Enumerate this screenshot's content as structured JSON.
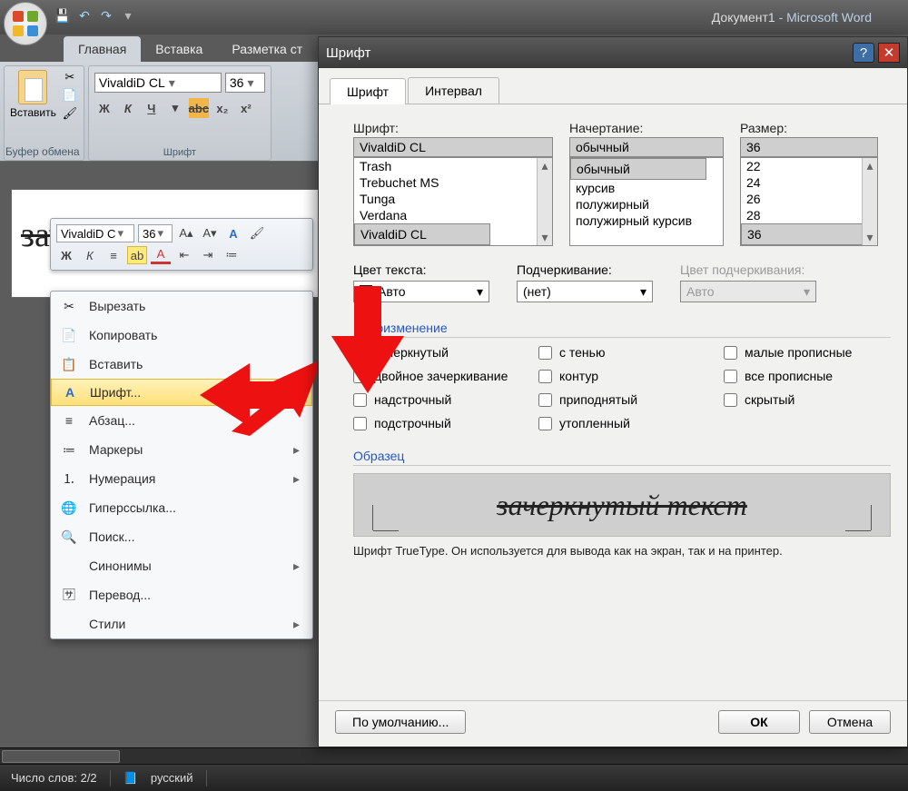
{
  "titlebar": {
    "doc": "Документ1",
    "app": "Microsoft Word"
  },
  "ribbon": {
    "tabs": {
      "home": "Главная",
      "insert": "Вставка",
      "layout": "Разметка ст"
    },
    "clipboard_label": "Буфер обмена",
    "paste": "Вставить",
    "font_label": "Шрифт",
    "font_name": "VivaldiD CL",
    "font_size": "36"
  },
  "mini": {
    "font_name": "VivaldiD C",
    "font_size": "36"
  },
  "contextmenu": {
    "cut": "Вырезать",
    "copy": "Копировать",
    "paste": "Вставить",
    "font": "Шрифт...",
    "paragraph": "Абзац...",
    "bullets": "Маркеры",
    "numbering": "Нумерация",
    "hyperlink": "Гиперссылка...",
    "search": "Поиск...",
    "synonyms": "Синонимы",
    "translate": "Перевод...",
    "styles": "Стили"
  },
  "dialog": {
    "title": "Шрифт",
    "tabs": {
      "font": "Шрифт",
      "spacing": "Интервал"
    },
    "labels": {
      "font": "Шрифт:",
      "style": "Начертание:",
      "size": "Размер:"
    },
    "values": {
      "font": "VivaldiD CL",
      "style": "обычный",
      "size": "36"
    },
    "font_list": [
      "Trash",
      "Trebuchet MS",
      "Tunga",
      "Verdana",
      "VivaldiD CL"
    ],
    "style_list": [
      "обычный",
      "курсив",
      "полужирный",
      "полужирный курсив"
    ],
    "size_list": [
      "22",
      "24",
      "26",
      "28",
      "36"
    ],
    "color_label": "Цвет текста:",
    "color_value": "Авто",
    "underline_label": "Подчеркивание:",
    "underline_value": "(нет)",
    "undercolor_label": "Цвет подчеркивания:",
    "undercolor_value": "Авто",
    "effects_title": "Видоизменение",
    "effects": {
      "strike": "зачеркнутый",
      "dstrike": "двойное зачеркивание",
      "sup": "надстрочный",
      "sub": "подстрочный",
      "shadow": "с тенью",
      "outline": "контур",
      "emboss": "приподнятый",
      "engrave": "утопленный",
      "smallcaps": "малые прописные",
      "allcaps": "все прописные",
      "hidden": "скрытый"
    },
    "sample_title": "Образец",
    "sample_text": "зачеркнутый текст",
    "truetype": "Шрифт TrueType. Он используется для вывода как на экран, так и на принтер.",
    "buttons": {
      "default": "По умолчанию...",
      "ok": "ОК",
      "cancel": "Отмена"
    }
  },
  "statusbar": {
    "words": "Число слов: 2/2",
    "lang": "русский"
  }
}
